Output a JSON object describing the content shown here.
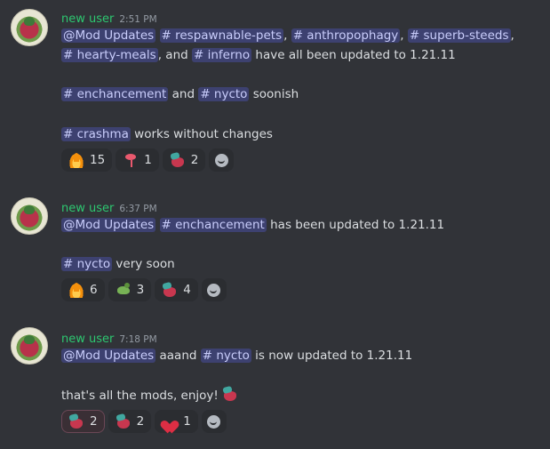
{
  "messages": [
    {
      "username": "new user",
      "time": "2:51 PM",
      "line1": {
        "m1": "@Mod Updates",
        "c1": "# respawnable-pets",
        "s1": ",",
        "c2": "# anthropophagy",
        "s2": ",",
        "c3": "# superb-steeds",
        "s3": ","
      },
      "line2": {
        "c1": "# hearty-meals",
        "s1": ", and",
        "c2": "# inferno",
        "s2": "have all been updated to 1.21.11"
      },
      "line3": {
        "c1": "# enchancement",
        "s1": "and",
        "c2": "# nycto",
        "s2": "soonish"
      },
      "line4": {
        "c1": "# crashma",
        "s1": "works without changes"
      },
      "reactions": [
        {
          "emoji": "fire-emoji",
          "count": "15"
        },
        {
          "emoji": "flamingo-emoji",
          "count": "1"
        },
        {
          "emoji": "custom-mod-emoji",
          "count": "2"
        }
      ]
    },
    {
      "username": "new user",
      "time": "6:37 PM",
      "line1": {
        "m1": "@Mod Updates",
        "c1": "# enchancement",
        "s1": "has been updated to 1.21.11"
      },
      "line2": {
        "c1": "# nycto",
        "s1": "very soon"
      },
      "reactions": [
        {
          "emoji": "fire-emoji",
          "count": "6"
        },
        {
          "emoji": "dinosaur-emoji",
          "count": "3"
        },
        {
          "emoji": "custom-mod-emoji",
          "count": "4"
        }
      ]
    },
    {
      "username": "new user",
      "time": "7:18 PM",
      "line1": {
        "m1": "@Mod Updates",
        "s1": "aaand",
        "c1": "# nycto",
        "s2": "is now updated to 1.21.11"
      },
      "line2": {
        "s1": "that's all the mods, enjoy!"
      },
      "reactions": [
        {
          "emoji": "custom-mod-emoji",
          "count": "2",
          "active": true
        },
        {
          "emoji": "custom-mod-emoji",
          "count": "2"
        },
        {
          "emoji": "heart-emoji",
          "count": "1"
        }
      ]
    }
  ],
  "colors": {
    "background": "#313338",
    "username": "#2dc770",
    "mention_bg": "#5865f2",
    "reaction_bg": "#2b2d31"
  }
}
